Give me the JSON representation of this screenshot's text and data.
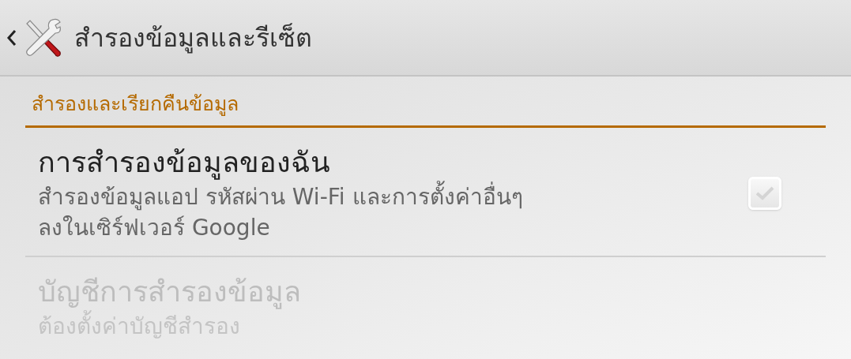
{
  "action_bar": {
    "title": "สำรองข้อมูลและรีเซ็ต"
  },
  "section": {
    "header": "สำรองและเรียกคืนข้อมูล"
  },
  "items": [
    {
      "kind": "checkbox",
      "title": "การสำรองข้อมูลของฉัน",
      "summary": "สำรองข้อมูลแอป รหัสผ่าน Wi-Fi และการตั้งค่าอื่นๆ\nลงในเซิร์ฟเวอร์ Google",
      "checked": true,
      "disabled": false
    },
    {
      "kind": "plain",
      "title": "บัญชีการสำรองข้อมูล",
      "summary": "ต้องตั้งค่าบัญชีสำรอง",
      "disabled": true
    }
  ]
}
